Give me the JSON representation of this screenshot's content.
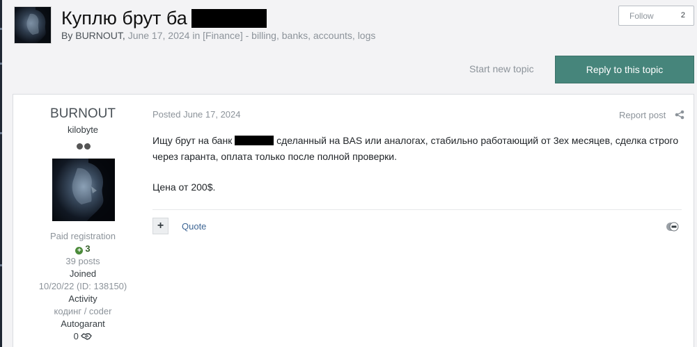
{
  "topic": {
    "title": "Куплю брут ба",
    "by_label": "By",
    "author": "BURNOUT,",
    "date": "June 17, 2024",
    "in_label": "in",
    "forum": "[Finance]",
    "tags": "- billing, banks, accounts, logs",
    "follow_label": "Follow",
    "follow_count": "2"
  },
  "actions": {
    "start_new_topic": "Start new topic",
    "reply": "Reply to this topic"
  },
  "post": {
    "author": {
      "name": "BURNOUT",
      "rank": "kilobyte",
      "group": "Paid registration",
      "reputation": "3",
      "posts": "39 posts",
      "joined_label": "Joined",
      "joined_value": "10/20/22 (ID: 138150)",
      "activity_label": "Activity",
      "activity_value": "кодинг / coder",
      "autogarant_label": "Autogarant",
      "autogarant_value": "0"
    },
    "posted": "Posted June 17, 2024",
    "report": "Report post",
    "text_1a": "Ищу брут на банк",
    "text_1b": "сделанный на BAS или аналогах, стабильно работающий от 3ех месяцев, сделка строго через гаранта, оплата только после полной проверки.",
    "text_2": "Цена от 200$.",
    "multiquote": "+",
    "quote": "Quote"
  },
  "colors": {
    "accent": "#46857b",
    "link": "#3d6594",
    "muted": "#8c939a"
  }
}
